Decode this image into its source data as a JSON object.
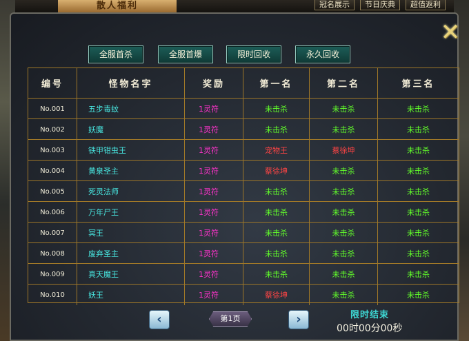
{
  "top_banner": "散人福利",
  "top_buttons": [
    "冠名展示",
    "节日庆典",
    "超值返利"
  ],
  "tabs": [
    "全服首杀",
    "全服首爆",
    "限时回收",
    "永久回收"
  ],
  "table": {
    "headers": [
      "编号",
      "怪物名字",
      "奖励",
      "第一名",
      "第二名",
      "第三名"
    ],
    "rows": [
      {
        "id": "No.001",
        "name": "五步毒蚊",
        "reward": "1灵符",
        "first": "未击杀",
        "second": "未击杀",
        "third": "未击杀",
        "first_color": "green",
        "second_color": "green",
        "third_color": "green"
      },
      {
        "id": "No.002",
        "name": "妖魔",
        "reward": "1灵符",
        "first": "未击杀",
        "second": "未击杀",
        "third": "未击杀",
        "first_color": "green",
        "second_color": "green",
        "third_color": "green"
      },
      {
        "id": "No.003",
        "name": "铁甲钳虫王",
        "reward": "1灵符",
        "first": "宠物王",
        "second": "蔡徐坤",
        "third": "未击杀",
        "first_color": "red",
        "second_color": "red",
        "third_color": "green"
      },
      {
        "id": "No.004",
        "name": "黄泉圣主",
        "reward": "1灵符",
        "first": "蔡徐坤",
        "second": "未击杀",
        "third": "未击杀",
        "first_color": "red",
        "second_color": "green",
        "third_color": "green"
      },
      {
        "id": "No.005",
        "name": "死灵法师",
        "reward": "1灵符",
        "first": "未击杀",
        "second": "未击杀",
        "third": "未击杀",
        "first_color": "green",
        "second_color": "green",
        "third_color": "green"
      },
      {
        "id": "No.006",
        "name": "万年尸王",
        "reward": "1灵符",
        "first": "未击杀",
        "second": "未击杀",
        "third": "未击杀",
        "first_color": "green",
        "second_color": "green",
        "third_color": "green"
      },
      {
        "id": "No.007",
        "name": "冥王",
        "reward": "1灵符",
        "first": "未击杀",
        "second": "未击杀",
        "third": "未击杀",
        "first_color": "green",
        "second_color": "green",
        "third_color": "green"
      },
      {
        "id": "No.008",
        "name": "废弃圣主",
        "reward": "1灵符",
        "first": "未击杀",
        "second": "未击杀",
        "third": "未击杀",
        "first_color": "green",
        "second_color": "green",
        "third_color": "green"
      },
      {
        "id": "No.009",
        "name": "真天魔王",
        "reward": "1灵符",
        "first": "未击杀",
        "second": "未击杀",
        "third": "未击杀",
        "first_color": "green",
        "second_color": "green",
        "third_color": "green"
      },
      {
        "id": "No.010",
        "name": "妖王",
        "reward": "1灵符",
        "first": "蔡徐坤",
        "second": "未击杀",
        "third": "未击杀",
        "first_color": "red",
        "second_color": "green",
        "third_color": "green"
      }
    ]
  },
  "pager": {
    "prev_icon": "chevron-left-icon",
    "label": "第1页",
    "next_icon": "chevron-right-icon"
  },
  "timer": {
    "title": "限时结束",
    "value": "00时00分00秒"
  },
  "colors": {
    "accent_teal": "#1d5e58",
    "killed_red": "#ff4444",
    "unkilled_green": "#62ff2a",
    "monster_name": "#48e6e0",
    "reward": "#ff33cc",
    "grid_border": "#a07828"
  }
}
